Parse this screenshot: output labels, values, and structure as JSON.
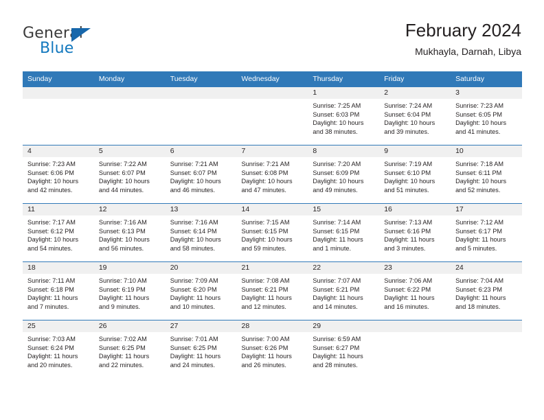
{
  "brand": {
    "word1": "General",
    "word2": "Blue",
    "triangle_color": "#1767ab",
    "blue_color": "#1278be"
  },
  "header": {
    "title": "February 2024",
    "subtitle": "Mukhayla, Darnah, Libya"
  },
  "theme": {
    "header_row_bg": "#3079b8",
    "daynum_bg": "#f0f0f0",
    "grid_line": "#3079b8",
    "text": "#231f20"
  },
  "calendar": {
    "weekdays": [
      "Sunday",
      "Monday",
      "Tuesday",
      "Wednesday",
      "Thursday",
      "Friday",
      "Saturday"
    ],
    "weeks": [
      [
        {
          "day": "",
          "lines": []
        },
        {
          "day": "",
          "lines": []
        },
        {
          "day": "",
          "lines": []
        },
        {
          "day": "",
          "lines": []
        },
        {
          "day": "1",
          "lines": [
            "Sunrise: 7:25 AM",
            "Sunset: 6:03 PM",
            "Daylight: 10 hours",
            "and 38 minutes."
          ]
        },
        {
          "day": "2",
          "lines": [
            "Sunrise: 7:24 AM",
            "Sunset: 6:04 PM",
            "Daylight: 10 hours",
            "and 39 minutes."
          ]
        },
        {
          "day": "3",
          "lines": [
            "Sunrise: 7:23 AM",
            "Sunset: 6:05 PM",
            "Daylight: 10 hours",
            "and 41 minutes."
          ]
        }
      ],
      [
        {
          "day": "4",
          "lines": [
            "Sunrise: 7:23 AM",
            "Sunset: 6:06 PM",
            "Daylight: 10 hours",
            "and 42 minutes."
          ]
        },
        {
          "day": "5",
          "lines": [
            "Sunrise: 7:22 AM",
            "Sunset: 6:07 PM",
            "Daylight: 10 hours",
            "and 44 minutes."
          ]
        },
        {
          "day": "6",
          "lines": [
            "Sunrise: 7:21 AM",
            "Sunset: 6:07 PM",
            "Daylight: 10 hours",
            "and 46 minutes."
          ]
        },
        {
          "day": "7",
          "lines": [
            "Sunrise: 7:21 AM",
            "Sunset: 6:08 PM",
            "Daylight: 10 hours",
            "and 47 minutes."
          ]
        },
        {
          "day": "8",
          "lines": [
            "Sunrise: 7:20 AM",
            "Sunset: 6:09 PM",
            "Daylight: 10 hours",
            "and 49 minutes."
          ]
        },
        {
          "day": "9",
          "lines": [
            "Sunrise: 7:19 AM",
            "Sunset: 6:10 PM",
            "Daylight: 10 hours",
            "and 51 minutes."
          ]
        },
        {
          "day": "10",
          "lines": [
            "Sunrise: 7:18 AM",
            "Sunset: 6:11 PM",
            "Daylight: 10 hours",
            "and 52 minutes."
          ]
        }
      ],
      [
        {
          "day": "11",
          "lines": [
            "Sunrise: 7:17 AM",
            "Sunset: 6:12 PM",
            "Daylight: 10 hours",
            "and 54 minutes."
          ]
        },
        {
          "day": "12",
          "lines": [
            "Sunrise: 7:16 AM",
            "Sunset: 6:13 PM",
            "Daylight: 10 hours",
            "and 56 minutes."
          ]
        },
        {
          "day": "13",
          "lines": [
            "Sunrise: 7:16 AM",
            "Sunset: 6:14 PM",
            "Daylight: 10 hours",
            "and 58 minutes."
          ]
        },
        {
          "day": "14",
          "lines": [
            "Sunrise: 7:15 AM",
            "Sunset: 6:15 PM",
            "Daylight: 10 hours",
            "and 59 minutes."
          ]
        },
        {
          "day": "15",
          "lines": [
            "Sunrise: 7:14 AM",
            "Sunset: 6:15 PM",
            "Daylight: 11 hours",
            "and 1 minute."
          ]
        },
        {
          "day": "16",
          "lines": [
            "Sunrise: 7:13 AM",
            "Sunset: 6:16 PM",
            "Daylight: 11 hours",
            "and 3 minutes."
          ]
        },
        {
          "day": "17",
          "lines": [
            "Sunrise: 7:12 AM",
            "Sunset: 6:17 PM",
            "Daylight: 11 hours",
            "and 5 minutes."
          ]
        }
      ],
      [
        {
          "day": "18",
          "lines": [
            "Sunrise: 7:11 AM",
            "Sunset: 6:18 PM",
            "Daylight: 11 hours",
            "and 7 minutes."
          ]
        },
        {
          "day": "19",
          "lines": [
            "Sunrise: 7:10 AM",
            "Sunset: 6:19 PM",
            "Daylight: 11 hours",
            "and 9 minutes."
          ]
        },
        {
          "day": "20",
          "lines": [
            "Sunrise: 7:09 AM",
            "Sunset: 6:20 PM",
            "Daylight: 11 hours",
            "and 10 minutes."
          ]
        },
        {
          "day": "21",
          "lines": [
            "Sunrise: 7:08 AM",
            "Sunset: 6:21 PM",
            "Daylight: 11 hours",
            "and 12 minutes."
          ]
        },
        {
          "day": "22",
          "lines": [
            "Sunrise: 7:07 AM",
            "Sunset: 6:21 PM",
            "Daylight: 11 hours",
            "and 14 minutes."
          ]
        },
        {
          "day": "23",
          "lines": [
            "Sunrise: 7:06 AM",
            "Sunset: 6:22 PM",
            "Daylight: 11 hours",
            "and 16 minutes."
          ]
        },
        {
          "day": "24",
          "lines": [
            "Sunrise: 7:04 AM",
            "Sunset: 6:23 PM",
            "Daylight: 11 hours",
            "and 18 minutes."
          ]
        }
      ],
      [
        {
          "day": "25",
          "lines": [
            "Sunrise: 7:03 AM",
            "Sunset: 6:24 PM",
            "Daylight: 11 hours",
            "and 20 minutes."
          ]
        },
        {
          "day": "26",
          "lines": [
            "Sunrise: 7:02 AM",
            "Sunset: 6:25 PM",
            "Daylight: 11 hours",
            "and 22 minutes."
          ]
        },
        {
          "day": "27",
          "lines": [
            "Sunrise: 7:01 AM",
            "Sunset: 6:25 PM",
            "Daylight: 11 hours",
            "and 24 minutes."
          ]
        },
        {
          "day": "28",
          "lines": [
            "Sunrise: 7:00 AM",
            "Sunset: 6:26 PM",
            "Daylight: 11 hours",
            "and 26 minutes."
          ]
        },
        {
          "day": "29",
          "lines": [
            "Sunrise: 6:59 AM",
            "Sunset: 6:27 PM",
            "Daylight: 11 hours",
            "and 28 minutes."
          ]
        },
        {
          "day": "",
          "lines": []
        },
        {
          "day": "",
          "lines": []
        }
      ]
    ]
  }
}
